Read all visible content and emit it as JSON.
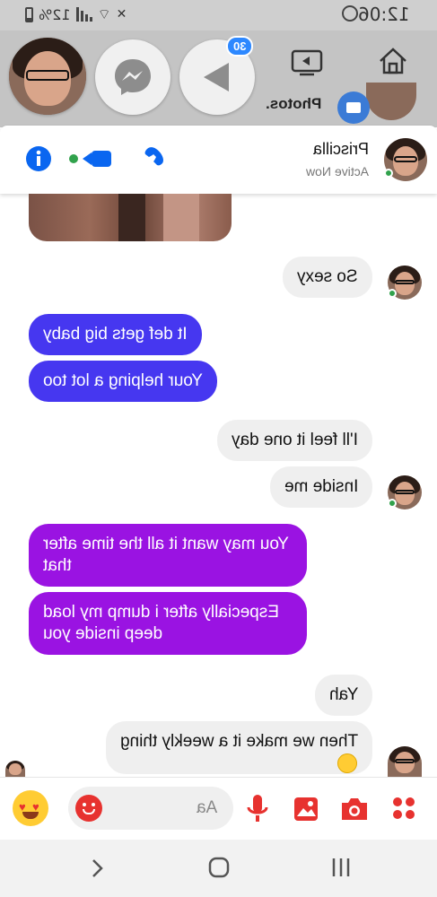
{
  "status_bar": {
    "time": "12:06",
    "battery": "12%"
  },
  "chat_heads": {
    "badge_count": "30"
  },
  "behind": {
    "photos_text": "Photos."
  },
  "conversation": {
    "name": "Priscilla",
    "status": "Active Now"
  },
  "messages": [
    {
      "from": "contact",
      "text": "So sexy"
    },
    {
      "from": "me",
      "text": "It def gets big baby"
    },
    {
      "from": "me",
      "text": "Your helping a lot too"
    },
    {
      "from": "contact",
      "text": "I'll feel it one day"
    },
    {
      "from": "contact",
      "text": "Inside me"
    },
    {
      "from": "me",
      "text": "You may want it all the time after that"
    },
    {
      "from": "me",
      "text": "Especially after i dump my load deep inside you"
    },
    {
      "from": "contact",
      "text": "Yah"
    },
    {
      "from": "contact",
      "text": "Then we make it a weekly thing"
    }
  ],
  "composer": {
    "placeholder": "Aa"
  },
  "colors": {
    "accent": "#2d88ff",
    "composer_icon": "#e7322f",
    "bubble_blue": "#4637f0",
    "bubble_purple": "#9a13e2"
  },
  "icons": [
    "home-icon",
    "video-tab-icon",
    "messenger-icon",
    "send-icon",
    "info-icon",
    "video-call-icon",
    "phone-icon",
    "apps-icon",
    "camera-icon",
    "gallery-icon",
    "mic-icon",
    "emoji-icon",
    "heart-eyes-icon",
    "back-icon",
    "home-nav-icon",
    "recents-icon"
  ]
}
